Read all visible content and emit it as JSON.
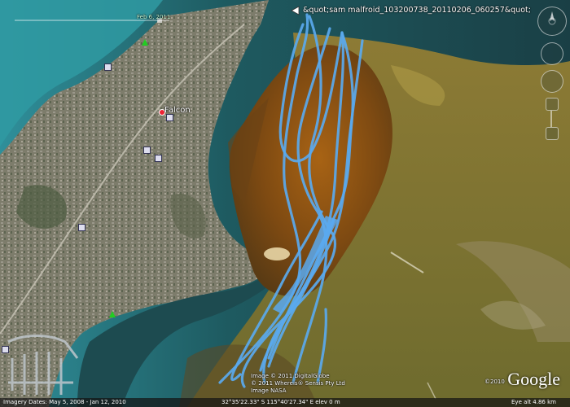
{
  "track": {
    "label": "&quot;sam malfroid_103200738_20110206_060257&quot;",
    "color": "#5aa9ee"
  },
  "place": {
    "name": "Falcon"
  },
  "time_slider": {
    "label": "Feb 6, 2011"
  },
  "attribution": {
    "line1": "Image © 2011 DigitalGlobe",
    "line2": "© 2011 Whereis® Sensis Pty Ltd",
    "line3": "Image NASA",
    "logo_year": "©2010",
    "logo": "Google"
  },
  "status": {
    "imagery_dates": "Imagery Dates: May 5, 2008 - Jan 12, 2010",
    "coordinates": "32°35'22.33\" S   115°40'27.34\" E   elev  0 m",
    "eye_alt": "Eye alt   4.86 km"
  },
  "colors": {
    "ocean": "#1f4f55",
    "land": "#7b7a6a",
    "estuary_orange": "#9a5a1a",
    "estuary_olive": "#8a7a2a"
  }
}
